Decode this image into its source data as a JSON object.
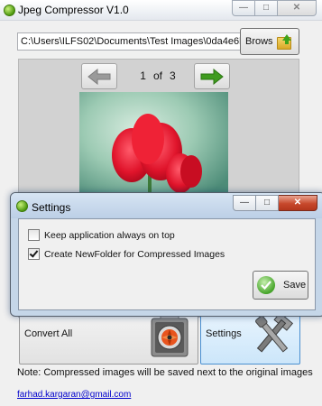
{
  "app": {
    "title": "Jpeg Compressor V1.0"
  },
  "path": {
    "value": "C:\\Users\\ILFS02\\Documents\\Test Images\\0da4e6b"
  },
  "browse": {
    "label": "Brows"
  },
  "navigator": {
    "current": "1",
    "of_label": "of",
    "total": "3"
  },
  "actions": {
    "convert_label": "Convert All",
    "settings_label": "Settings"
  },
  "note": "Note: Compressed images will be saved next to the original images",
  "email": "farhad.kargaran@gmail.com",
  "settings_dialog": {
    "title": "Settings",
    "options": [
      {
        "label": "Keep application always on top",
        "checked": false
      },
      {
        "label": "Create NewFolder for Compressed Images",
        "checked": true
      }
    ],
    "save_label": "Save"
  },
  "colors": {
    "arrow_green": "#3f9b1f",
    "arrow_gray": "#9a9a9a",
    "link": "#0000cc"
  },
  "icons": [
    "app-icon",
    "folder-icon",
    "arrow-left-icon",
    "arrow-right-icon",
    "compress-icon",
    "tools-icon",
    "checkmark-icon"
  ]
}
